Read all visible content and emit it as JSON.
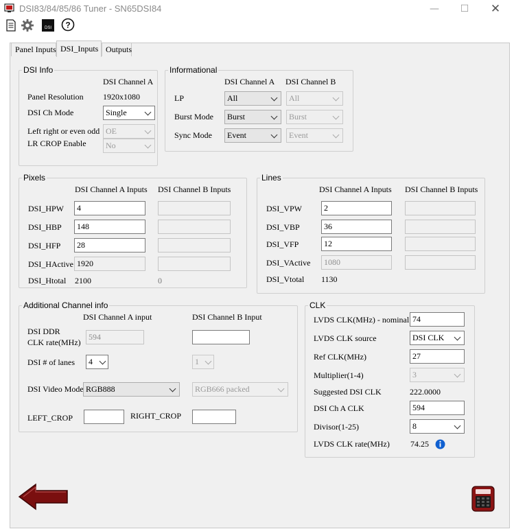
{
  "window": {
    "title": "DSI83/84/85/86 Tuner - SN65DSI84"
  },
  "tabs": [
    {
      "label": "Panel Inputs"
    },
    {
      "label": "DSI_Inputs"
    },
    {
      "label": "Outputs"
    }
  ],
  "dsi_info": {
    "title": "DSI Info",
    "channel_header": "DSI Channel A",
    "panel_resolution_label": "Panel Resolution",
    "panel_resolution_value": "1920x1080",
    "ch_mode_label": "DSI Ch Mode",
    "ch_mode_value": "Single",
    "left_right_label": "Left right or even odd",
    "left_right_value": "OE",
    "lr_crop_label": "LR CROP Enable",
    "lr_crop_value": "No"
  },
  "informational": {
    "title": "Informational",
    "header_a": "DSI Channel A",
    "header_b": "DSI Channel B",
    "rows": [
      {
        "label": "LP",
        "a": "All",
        "b": "All"
      },
      {
        "label": "Burst Mode",
        "a": "Burst",
        "b": "Burst"
      },
      {
        "label": "Sync Mode",
        "a": "Event",
        "b": "Event"
      }
    ]
  },
  "pixels": {
    "title": "Pixels",
    "header_a": "DSI Channel A Inputs",
    "header_b": "DSI Channel B Inputs",
    "rows": [
      {
        "label": "DSI_HPW",
        "a": "4",
        "b": ""
      },
      {
        "label": "DSI_HBP",
        "a": "148",
        "b": ""
      },
      {
        "label": "DSI_HFP",
        "a": "28",
        "b": ""
      },
      {
        "label": "DSI_HActive",
        "a": "1920",
        "b": ""
      }
    ],
    "total_label": "DSI_Htotal",
    "total_a": "2100",
    "total_b": "0"
  },
  "lines": {
    "title": "Lines",
    "header_a": "DSI Channel A Inputs",
    "header_b": "DSI Channel B Inputs",
    "rows": [
      {
        "label": "DSI_VPW",
        "a": "2",
        "b": ""
      },
      {
        "label": "DSI_VBP",
        "a": "36",
        "b": ""
      },
      {
        "label": "DSI_VFP",
        "a": "12",
        "b": ""
      },
      {
        "label": "DSI_VActive",
        "a": "1080",
        "b": ""
      }
    ],
    "total_label": "DSI_Vtotal",
    "total_a": "1130"
  },
  "additional": {
    "title": "Additional Channel info",
    "header_a": "DSI Channel A input",
    "header_b": "DSI Channel B Input",
    "ddr_label_1": "DSI DDR",
    "ddr_label_2": "CLK rate(MHz)",
    "ddr_a": "594",
    "ddr_b": "",
    "lanes_label": "DSI # of lanes",
    "lanes_a": "4",
    "lanes_b": "1",
    "video_mode_label": "DSI Video Mode",
    "video_mode_a": "RGB888",
    "video_mode_b": "RGB666 packed",
    "left_crop_label": "LEFT_CROP",
    "left_crop_value": "",
    "right_crop_label": "RIGHT_CROP",
    "right_crop_value": ""
  },
  "clk": {
    "title": "CLK",
    "lvds_nominal_label": "LVDS CLK(MHz) - nominal",
    "lvds_nominal_value": "74",
    "lvds_source_label": "LVDS CLK source",
    "lvds_source_value": "DSI CLK",
    "ref_clk_label": "Ref CLK(MHz)",
    "ref_clk_value": "27",
    "multiplier_label": "Multiplier(1-4)",
    "multiplier_value": "3",
    "suggested_label": "Suggested DSI CLK",
    "suggested_value": "222.0000",
    "dsi_cha_clk_label": "DSI Ch A CLK",
    "dsi_cha_clk_value": "594",
    "divisor_label": "Divisor(1-25)",
    "divisor_value": "8",
    "lvds_rate_label": "LVDS CLK rate(MHz)",
    "lvds_rate_value": "74.25"
  },
  "icons": {
    "app": "app-icon",
    "new_file": "document-icon",
    "settings": "gear-icon",
    "dsi": "dsi-icon",
    "help": "help-icon",
    "info": "info-icon",
    "back": "back-arrow-icon",
    "calculator": "calculator-icon"
  },
  "colors": {
    "dark_red": "#7a0f0f",
    "info_blue": "#1060d0",
    "panel_bg": "#f0f0f0"
  }
}
